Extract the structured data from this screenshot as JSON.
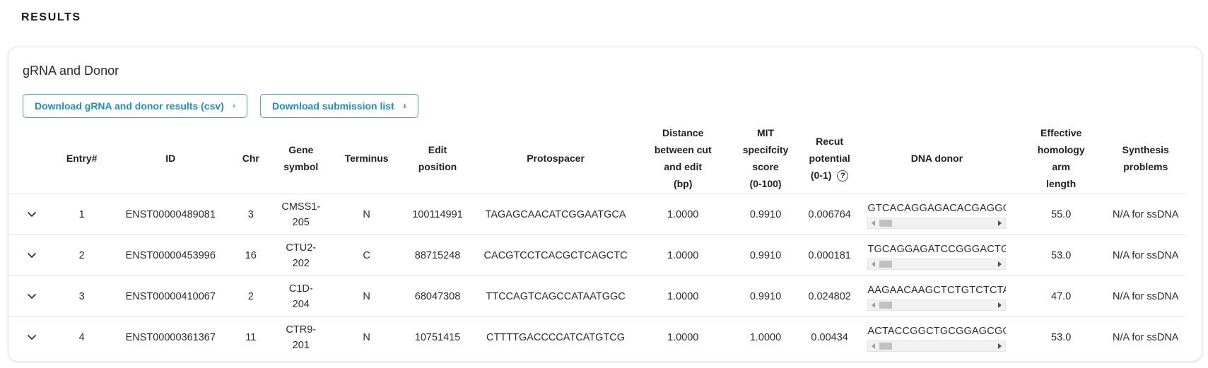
{
  "results_heading": "RESULTS",
  "card": {
    "title": "gRNA and Donor",
    "download_csv_label": "Download gRNA and donor results (csv)",
    "download_submission_label": "Download submission list"
  },
  "table": {
    "headers": {
      "entry": "Entry#",
      "id": "ID",
      "chr": "Chr",
      "gene_symbol_1": "Gene",
      "gene_symbol_2": "symbol",
      "terminus": "Terminus",
      "edit_position_1": "Edit",
      "edit_position_2": "position",
      "protospacer": "Protospacer",
      "distance_1": "Distance",
      "distance_2": "between cut",
      "distance_3": "and edit",
      "distance_4": "(bp)",
      "mit_1": "MIT",
      "mit_2": "specifcity",
      "mit_3": "score",
      "mit_4": "(0-100)",
      "recut_1": "Recut",
      "recut_2": "potential",
      "recut_3": "(0-1)",
      "recut_help": "?",
      "dna_donor": "DNA donor",
      "homology_1": "Effective",
      "homology_2": "homology",
      "homology_3": "arm",
      "homology_4": "length",
      "synthesis_1": "Synthesis",
      "synthesis_2": "problems"
    },
    "rows": [
      {
        "entry": "1",
        "id": "ENST00000489081",
        "chr": "3",
        "gene_symbol_1": "CMSS1-",
        "gene_symbol_2": "205",
        "terminus": "N",
        "edit_position": "100114991",
        "protospacer": "TAGAGCAACATCGGAATGCA",
        "distance": "1.0000",
        "mit_score": "0.9910",
        "recut": "0.006764",
        "dna_donor": "GTCACAGGAGACACGAGGGC",
        "homology": "55.0",
        "synthesis": "N/A for ssDNA"
      },
      {
        "entry": "2",
        "id": "ENST00000453996",
        "chr": "16",
        "gene_symbol_1": "CTU2-",
        "gene_symbol_2": "202",
        "terminus": "C",
        "edit_position": "88715248",
        "protospacer": "CACGTCCTCACGCTCAGCTC",
        "distance": "1.0000",
        "mit_score": "0.9910",
        "recut": "0.000181",
        "dna_donor": "TGCAGGAGATCCGGGACTGTC",
        "homology": "53.0",
        "synthesis": "N/A for ssDNA"
      },
      {
        "entry": "3",
        "id": "ENST00000410067",
        "chr": "2",
        "gene_symbol_1": "C1D-",
        "gene_symbol_2": "204",
        "terminus": "N",
        "edit_position": "68047308",
        "protospacer": "TTCCAGTCAGCCATAATGGC",
        "distance": "1.0000",
        "mit_score": "0.9910",
        "recut": "0.024802",
        "dna_donor": "AAGAACAAGCTCTGTCTCTAA",
        "homology": "47.0",
        "synthesis": "N/A for ssDNA"
      },
      {
        "entry": "4",
        "id": "ENST00000361367",
        "chr": "11",
        "gene_symbol_1": "CTR9-",
        "gene_symbol_2": "201",
        "terminus": "N",
        "edit_position": "10751415",
        "protospacer": "CTTTTGACCCCATCATGTCG",
        "distance": "1.0000",
        "mit_score": "1.0000",
        "recut": "0.00434",
        "dna_donor": "ACTACCGGCTGCGGAGCGGC",
        "homology": "53.0",
        "synthesis": "N/A for ssDNA"
      }
    ]
  },
  "icons": {
    "download": "download-icon",
    "expand": "chevron-down-icon",
    "help": "help-circle-icon"
  },
  "colors": {
    "accent": "#1b8fc6",
    "border": "#4aa6d3"
  }
}
